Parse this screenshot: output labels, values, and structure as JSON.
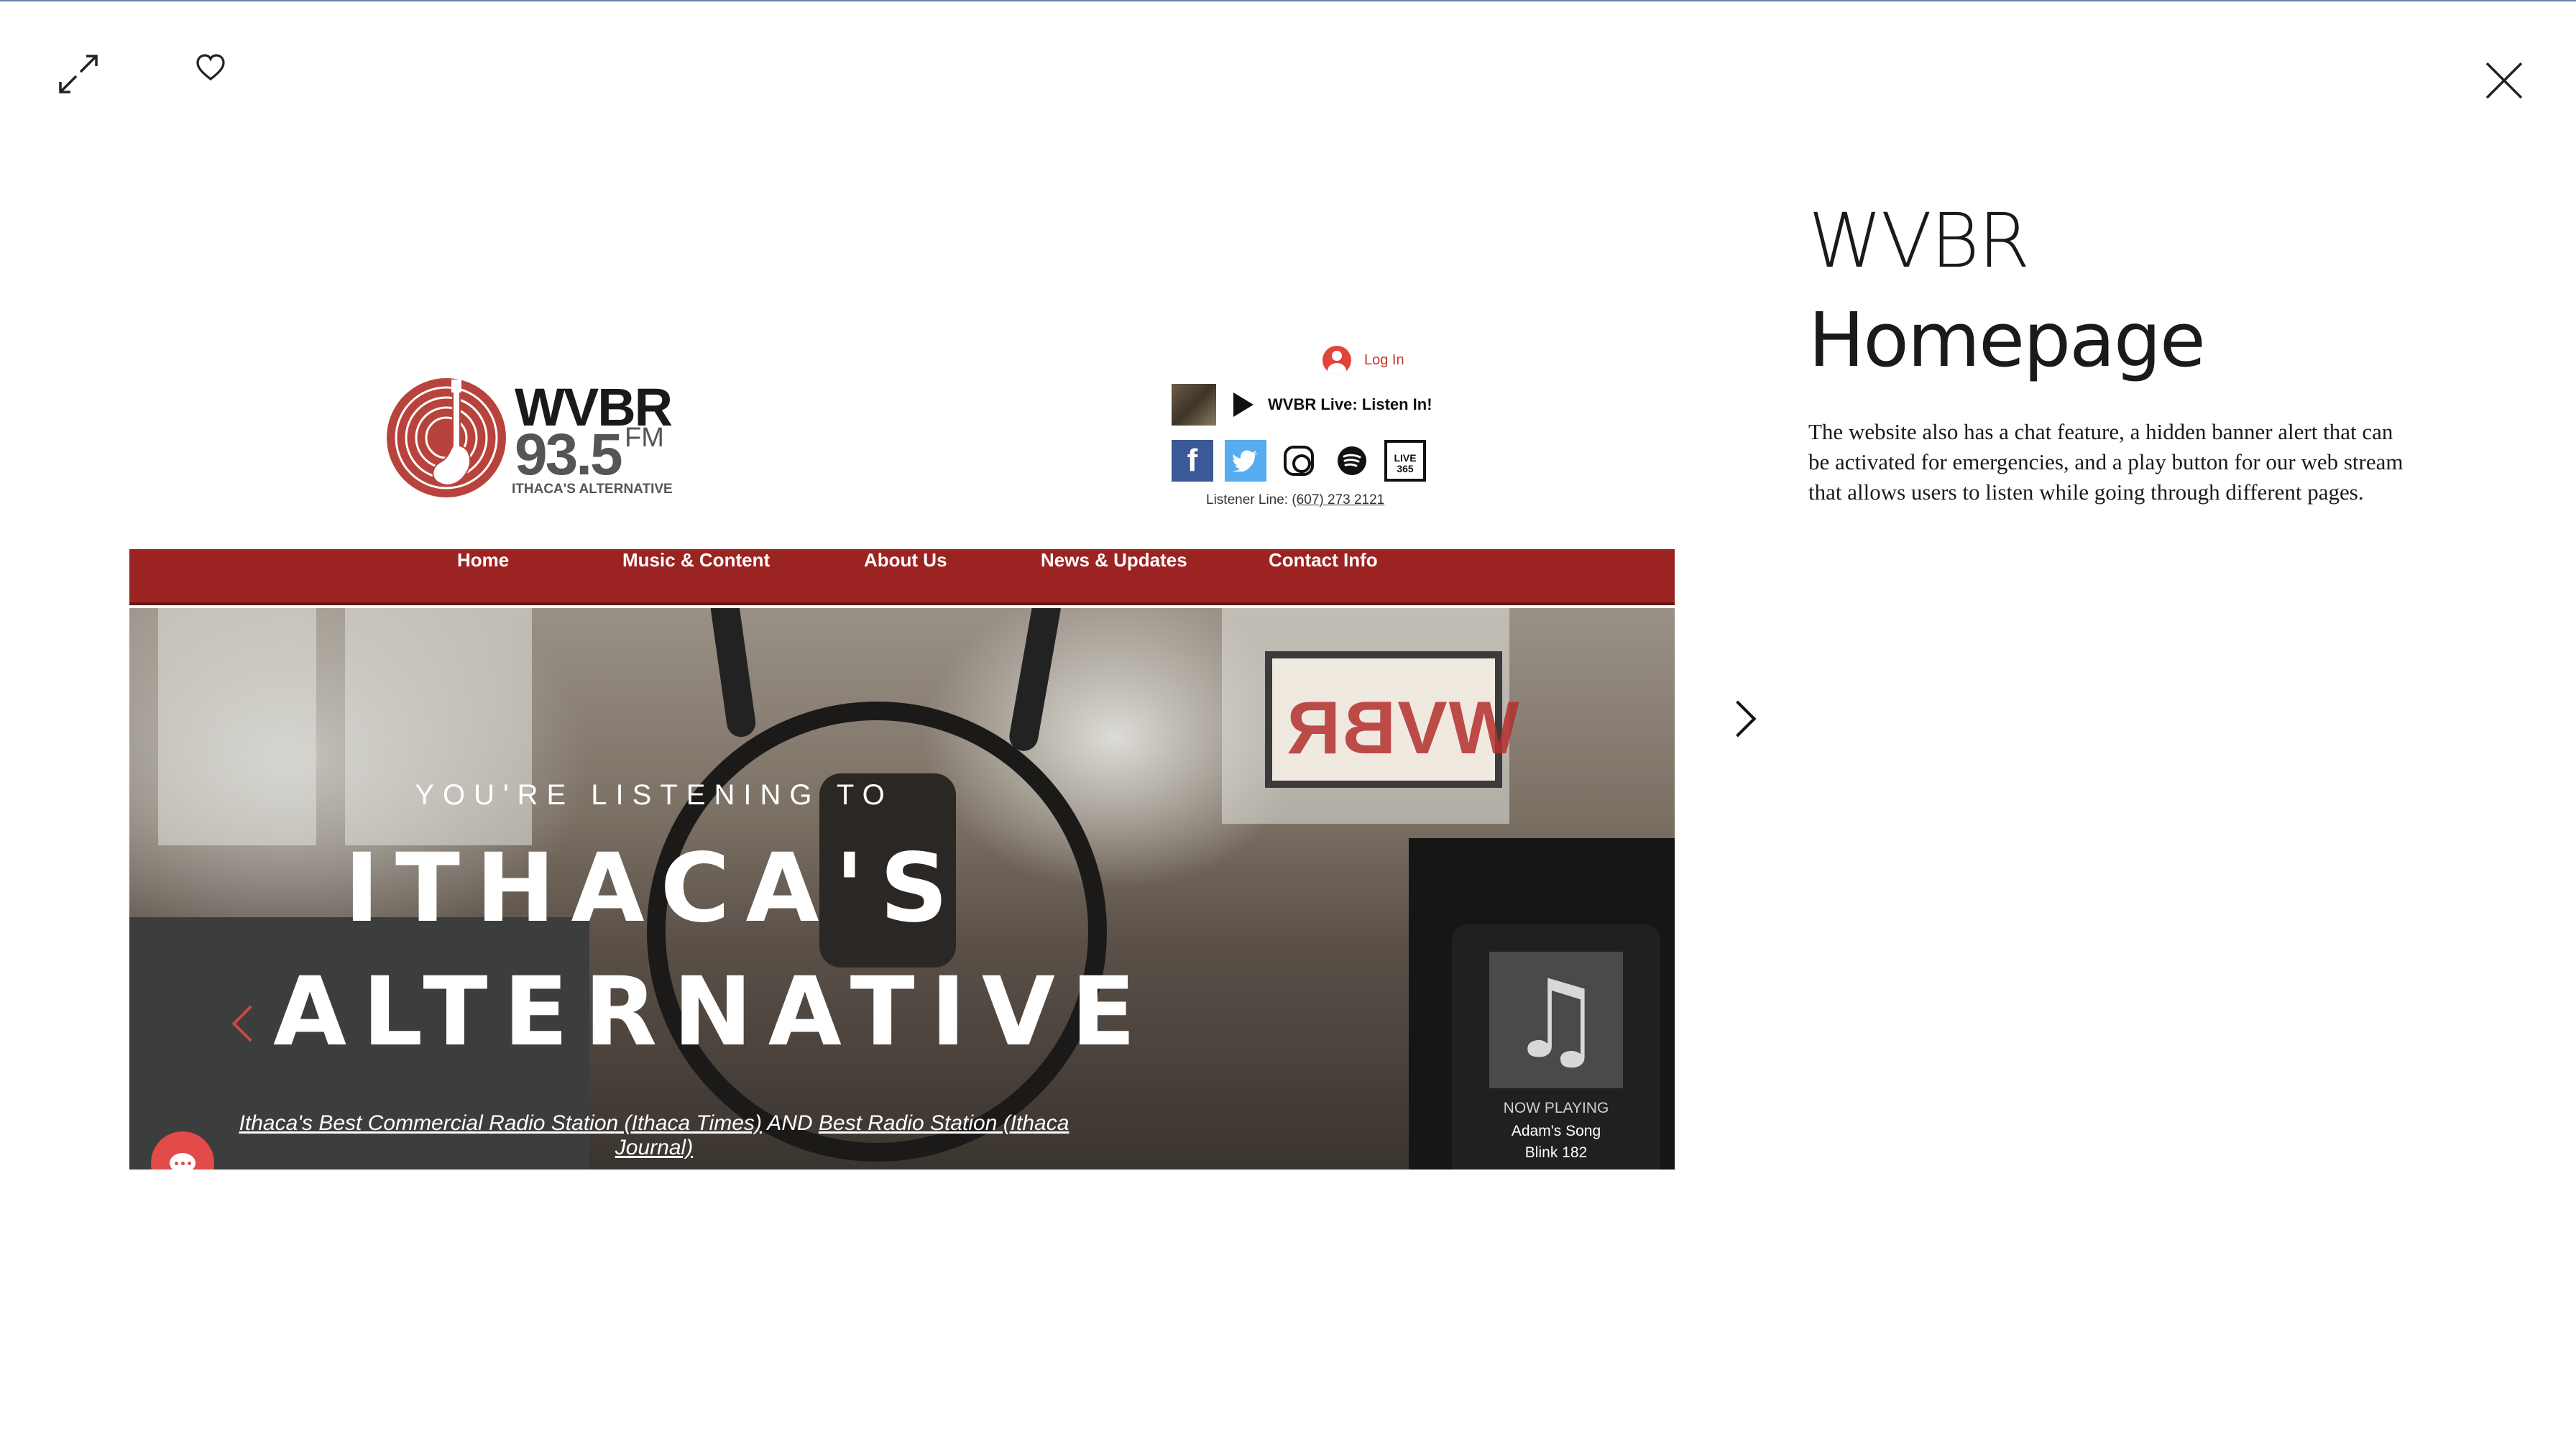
{
  "lightbox": {
    "expand_icon": "expand-icon",
    "like_icon": "heart-icon",
    "close_icon": "close-icon",
    "next_icon": "chevron-right-icon"
  },
  "project": {
    "title_line1": "WVBR",
    "title_line2": "Homepage",
    "description": "The website also has a chat feature, a hidden banner alert that can be activated for emergencies, and a play button for our web stream that allows users to listen while going through different pages."
  },
  "site": {
    "logo": {
      "name": "WVBR",
      "frequency": "93.5",
      "band": "FM",
      "tagline": "ITHACA'S ALTERNATIVE",
      "brand_color": "#b8433d"
    },
    "login_label": "Log In",
    "live_label": "WVBR Live: Listen In!",
    "social": [
      "facebook-icon",
      "twitter-icon",
      "instagram-icon",
      "spotify-icon",
      "live365-icon"
    ],
    "live365_text": "LIVE 365",
    "listener_line_label": "Listener Line:",
    "listener_line_number": "(607) 273 2121",
    "nav": [
      "Home",
      "Music & Content",
      "About Us",
      "News & Updates",
      "Contact Info"
    ],
    "nav_color": "#9b2321",
    "hero": {
      "sign_text": "WVBR",
      "subtitle": "YOU'RE LISTENING TO",
      "headline_line1": "ITHACA'S",
      "headline_line2": "ALTERNATIVE",
      "award1": "Ithaca's Best Commercial Radio Station (Ithaca Times)",
      "award_joiner": "AND",
      "award2": "Best Radio Station (Ithaca Journal)"
    },
    "now_playing": {
      "label": "NOW PLAYING",
      "song": "Adam's Song",
      "artist": "Blink 182"
    }
  }
}
